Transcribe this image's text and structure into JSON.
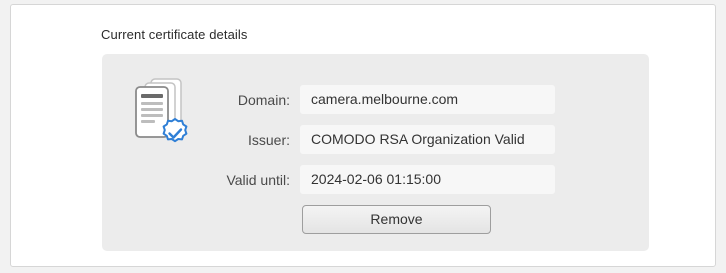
{
  "section": {
    "title": "Current certificate details"
  },
  "certificate": {
    "icon": "certificate-document-verified-icon",
    "rows": [
      {
        "label": "Domain:",
        "value": "camera.melbourne.com"
      },
      {
        "label": "Issuer:",
        "value": "COMODO RSA Organization Valid"
      },
      {
        "label": "Valid until:",
        "value": "2024-02-06 01:15:00"
      }
    ]
  },
  "actions": {
    "remove_label": "Remove"
  },
  "colors": {
    "accent_blue": "#2f7fd6",
    "panel_background": "#ececec",
    "card_background": "#ffffff"
  }
}
